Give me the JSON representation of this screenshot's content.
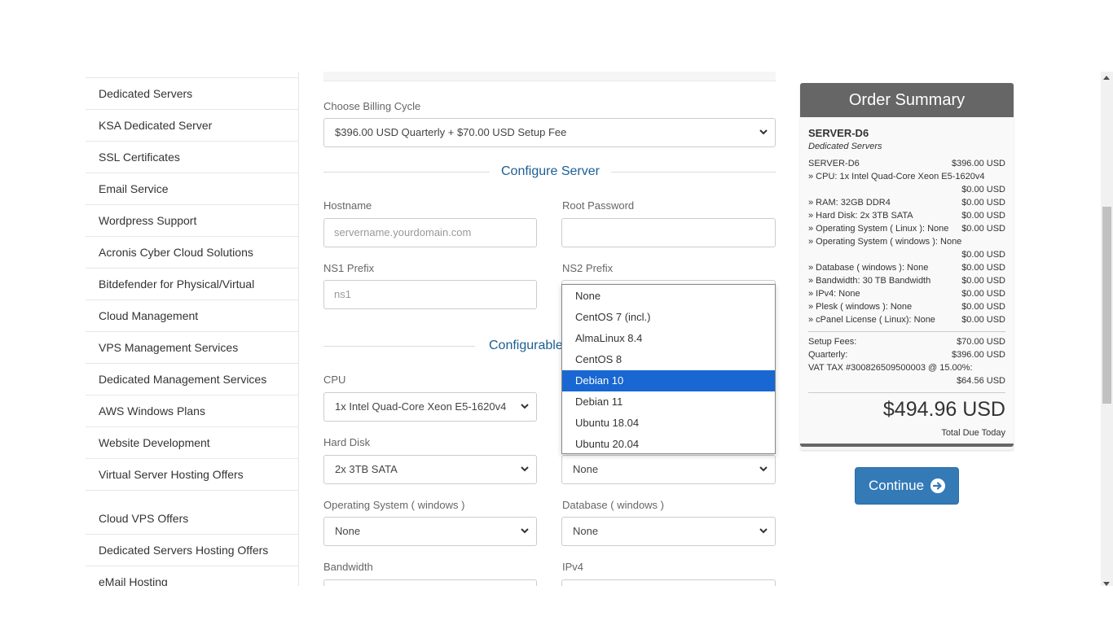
{
  "sidebar": {
    "items": [
      "Dedicated Servers",
      "KSA Dedicated Server",
      "SSL Certificates",
      "Email Service",
      "Wordpress Support",
      "Acronis Cyber Cloud Solutions",
      "Bitdefender for Physical/Virtual",
      "Cloud Management",
      "VPS Management Services",
      "Dedicated Management Services",
      "AWS Windows Plans",
      "Website Development",
      "Virtual Server Hosting Offers",
      "Cloud VPS Offers",
      "Dedicated Servers Hosting Offers",
      "eMail Hosting"
    ]
  },
  "billing": {
    "label": "Choose Billing Cycle",
    "value": "$396.00 USD Quarterly + $70.00 USD Setup Fee"
  },
  "configure_server": {
    "title": "Configure Server",
    "hostname_label": "Hostname",
    "hostname_placeholder": "servername.yourdomain.com",
    "root_password_label": "Root Password",
    "ns1_label": "NS1 Prefix",
    "ns1_value": "ns1",
    "ns2_label": "NS2 Prefix"
  },
  "configurable": {
    "title": "Configurable",
    "cpu_label": "CPU",
    "cpu_value": "1x Intel Quad-Core Xeon E5-1620v4",
    "hdd_label": "Hard Disk",
    "hdd_value": "2x 3TB SATA",
    "os_linux_value": "None",
    "os_windows_label": "Operating System ( windows )",
    "os_windows_value": "None",
    "db_windows_label": "Database ( windows )",
    "db_windows_value": "None",
    "bandwidth_label": "Bandwidth",
    "ipv4_label": "IPv4"
  },
  "dropdown": {
    "options": [
      "None",
      "CentOS 7 (incl.)",
      "AlmaLinux 8.4",
      "CentOS 8",
      "Debian 10",
      "Debian 11",
      "Ubuntu 18.04",
      "Ubuntu 20.04"
    ],
    "selected": "Debian 10"
  },
  "summary": {
    "title": "Order Summary",
    "product": "SERVER-D6",
    "group": "Dedicated Servers",
    "base_name": "SERVER-D6",
    "base_price": "$396.00 USD",
    "lines": [
      {
        "label": "» CPU: 1x Intel Quad-Core Xeon E5-1620v4",
        "price": "$0.00 USD"
      },
      {
        "label": "» RAM: 32GB DDR4",
        "price": "$0.00 USD"
      },
      {
        "label": "» Hard Disk: 2x 3TB SATA",
        "price": "$0.00 USD"
      },
      {
        "label": "» Operating System ( Linux ): None",
        "price": "$0.00 USD"
      },
      {
        "label": "» Operating System ( windows ): None",
        "price": "$0.00 USD"
      },
      {
        "label": "» Database ( windows ): None",
        "price": "$0.00 USD"
      },
      {
        "label": "» Bandwidth: 30 TB Bandwidth",
        "price": "$0.00 USD"
      },
      {
        "label": "» IPv4: None",
        "price": "$0.00 USD"
      },
      {
        "label": "» Plesk ( windows ): None",
        "price": "$0.00 USD"
      },
      {
        "label": "» cPanel License ( Linux): None",
        "price": "$0.00 USD"
      }
    ],
    "setup_label": "Setup Fees:",
    "setup_value": "$70.00 USD",
    "quarterly_label": "Quarterly:",
    "quarterly_value": "$396.00 USD",
    "vat_label": "VAT TAX #300826509500003 @ 15.00%:",
    "vat_value": "$64.56 USD",
    "total": "$494.96 USD",
    "total_label": "Total Due Today"
  },
  "continue_label": "Continue",
  "colors": {
    "accent": "#1c5e92",
    "button": "#337ab7",
    "summary_header": "#666666",
    "selected_option": "#1967d2"
  }
}
